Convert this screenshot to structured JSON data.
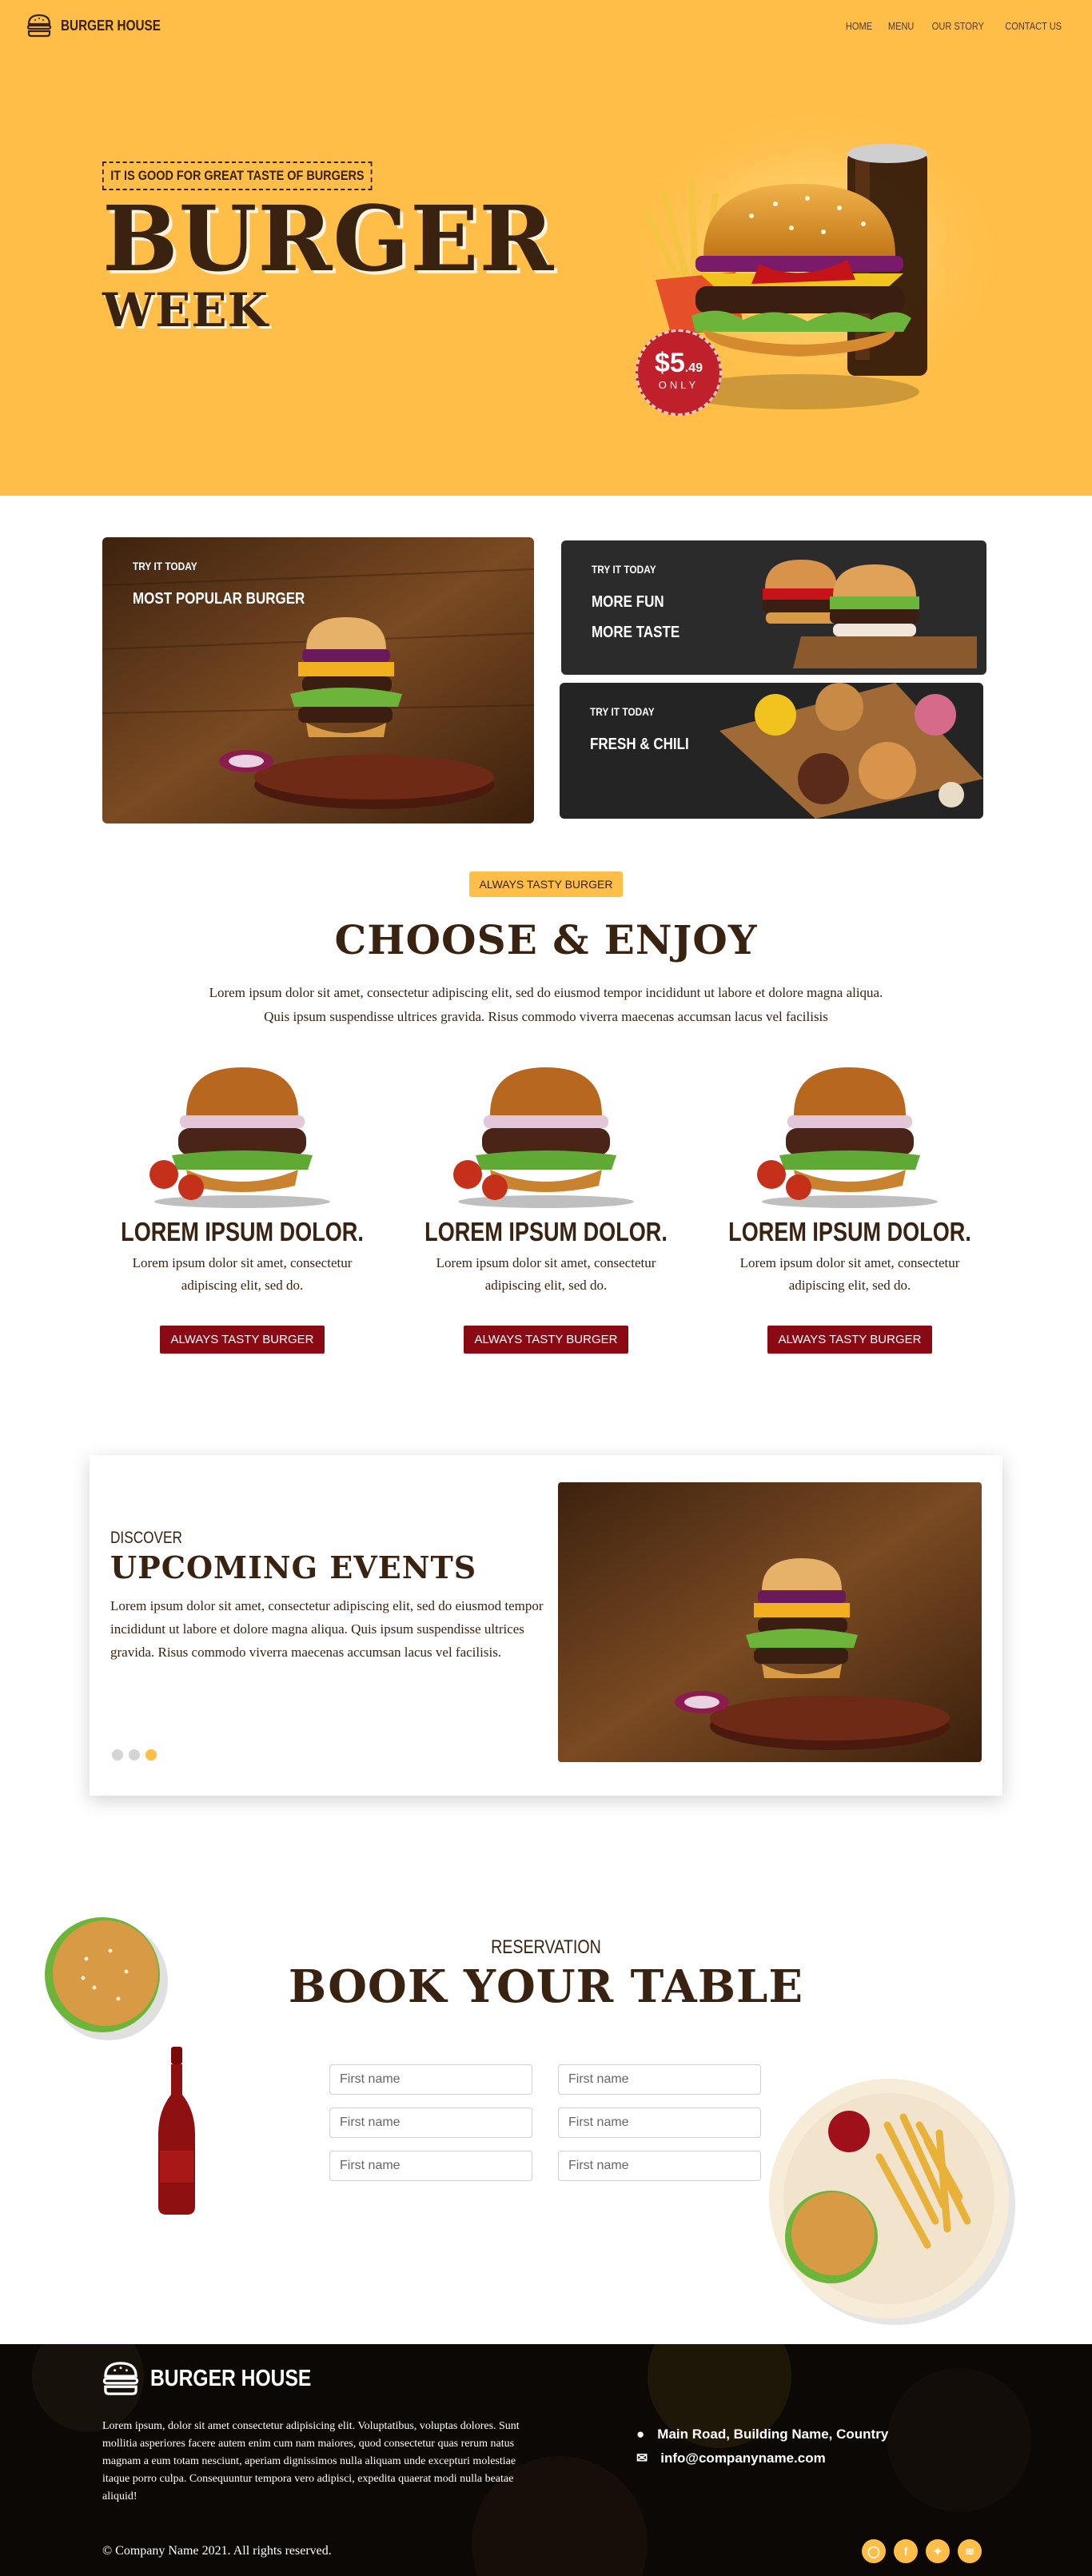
{
  "nav": {
    "brand": "BURGER HOUSE",
    "links": [
      "HOME",
      "MENU",
      "OUR STORY",
      "CONTACT US"
    ]
  },
  "hero": {
    "tagline": "IT IS GOOD FOR GREAT TASTE OF BURGERS",
    "title": "BURGER",
    "subtitle": "WEEK",
    "price": "$5",
    "price_cents": ".49",
    "price_note": "ONLY"
  },
  "promos": [
    {
      "tag": "TRY IT TODAY",
      "title_lines": [
        "MOST POPULAR BURGER"
      ]
    },
    {
      "tag": "TRY IT TODAY",
      "title_lines": [
        "MORE FUN",
        "MORE TASTE"
      ]
    },
    {
      "tag": "TRY IT TODAY",
      "title_lines": [
        "FRESH & CHILI"
      ]
    }
  ],
  "choose": {
    "badge": "ALWAYS TASTY BURGER",
    "title": "CHOOSE & ENJOY",
    "lead_line1": "Lorem ipsum dolor sit amet, consectetur adipiscing elit, sed do eiusmod tempor incididunt ut labore et dolore magna aliqua.",
    "lead_line2": "Quis ipsum suspendisse ultrices gravida. Risus commodo viverra maecenas accumsan lacus vel facilisis",
    "cards": [
      {
        "title": "LOREM IPSUM DOLOR.",
        "text": "Lorem ipsum dolor sit amet, consectetur adipiscing elit, sed do.",
        "button": "ALWAYS TASTY BURGER"
      },
      {
        "title": "LOREM IPSUM DOLOR.",
        "text": "Lorem ipsum dolor sit amet, consectetur adipiscing elit, sed do.",
        "button": "ALWAYS TASTY BURGER"
      },
      {
        "title": "LOREM IPSUM DOLOR.",
        "text": "Lorem ipsum dolor sit amet, consectetur adipiscing elit, sed do.",
        "button": "ALWAYS TASTY BURGER"
      }
    ]
  },
  "events": {
    "label": "DISCOVER",
    "title": "UPCOMING EVENTS",
    "text": "Lorem ipsum dolor sit amet, consectetur adipiscing elit, sed do eiusmod tempor incididunt ut labore et dolore magna aliqua. Quis ipsum suspendisse ultrices gravida. Risus commodo viverra maecenas accumsan lacus vel facilisis.",
    "slides": 3,
    "active_slide": 3
  },
  "booking": {
    "label": "RESERVATION",
    "title": "BOOK YOUR TABLE",
    "fields": [
      "First name",
      "First name",
      "First name",
      "First name",
      "First name",
      "First name"
    ]
  },
  "footer": {
    "brand": "BURGER HOUSE",
    "text": "Lorem ipsum, dolor sit amet consectetur adipisicing elit. Voluptatibus, voluptas dolores. Sunt mollitia asperiores facere autem enim cum nam maiores, quod consectetur quas rerum natus magnam a eum totam nesciunt, aperiam dignissimos nulla aliquam unde excepturi molestiae itaque porro culpa. Consequuntur tempora vero adipisci, expedita quaerat modi nulla beatae aliquid!",
    "address": "Main Road, Building Name, Country",
    "email": "info@companyname.com",
    "copyright": "© Company Name 2021. All rights reserved.",
    "social": [
      "instagram-icon",
      "facebook-icon",
      "twitter-icon",
      "rss-icon"
    ]
  },
  "colors": {
    "accent": "#ffbe47",
    "brown": "#3a2210",
    "button_red": "#8a0a14",
    "price_red": "#c0202a",
    "footer_bg": "#0d0b09"
  }
}
